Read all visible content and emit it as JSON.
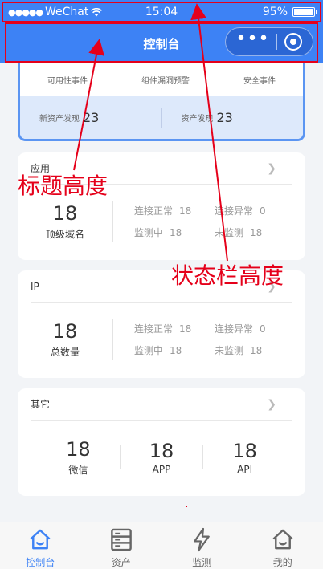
{
  "status_bar": {
    "carrier": "WeChat",
    "time": "15:04",
    "battery": "95%",
    "battery_level": 0.95
  },
  "nav": {
    "title": "控制台"
  },
  "summary": {
    "top_labels": [
      "可用性事件",
      "组件漏洞预警",
      "安全事件"
    ],
    "new_assets_label": "新资产发现",
    "new_assets_value": "23",
    "assets_label": "资产发现",
    "assets_value": "23"
  },
  "app_card": {
    "title": "应用",
    "big_value": "18",
    "big_label": "顶级域名",
    "stats": [
      {
        "label": "连接正常",
        "value": "18"
      },
      {
        "label": "连接异常",
        "value": "0"
      },
      {
        "label": "监测中",
        "value": "18"
      },
      {
        "label": "未监测",
        "value": "18"
      }
    ]
  },
  "ip_card": {
    "title": "IP",
    "big_value": "18",
    "big_label": "总数量",
    "stats": [
      {
        "label": "连接正常",
        "value": "18"
      },
      {
        "label": "连接异常",
        "value": "0"
      },
      {
        "label": "监测中",
        "value": "18"
      },
      {
        "label": "未监测",
        "value": "18"
      }
    ]
  },
  "other_card": {
    "title": "其它",
    "items": [
      {
        "value": "18",
        "label": "微信"
      },
      {
        "value": "18",
        "label": "APP"
      },
      {
        "value": "18",
        "label": "API"
      }
    ]
  },
  "annotations": {
    "title_height": "标题高度",
    "statusbar_height": "状态栏高度"
  },
  "tabs": [
    {
      "label": "控制台",
      "icon": "home-icon",
      "active": true
    },
    {
      "label": "资产",
      "icon": "server-icon",
      "active": false
    },
    {
      "label": "监测",
      "icon": "lightning-icon",
      "active": false
    },
    {
      "label": "我的",
      "icon": "home-outline-icon",
      "active": false
    }
  ],
  "colors": {
    "brand": "#3d82f5",
    "annotation": "#e5001a"
  }
}
